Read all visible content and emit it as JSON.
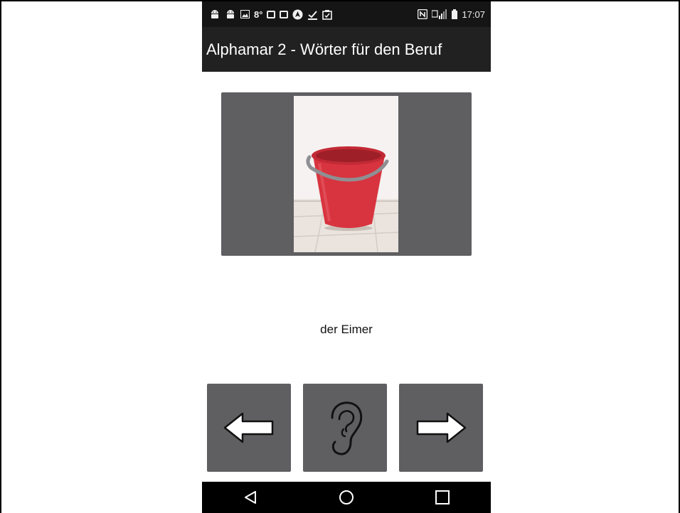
{
  "status_bar": {
    "left_icons": [
      "android-icon",
      "android-icon",
      "image-icon",
      "temperature-text",
      "app-icon",
      "app-icon",
      "navigation-icon",
      "download-done-icon",
      "clipboard-icon"
    ],
    "temperature": "8°",
    "right_icons": [
      "nfc-icon",
      "signal-icon",
      "battery-icon"
    ],
    "time": "17:07"
  },
  "app_bar": {
    "title": "Alphamar 2 - Wörter für den Beruf"
  },
  "card": {
    "image_subject": "red bucket"
  },
  "word": {
    "text": "der Eimer"
  },
  "controls": {
    "prev_icon": "left-arrow-icon",
    "listen_icon": "ear-icon",
    "next_icon": "right-arrow-icon"
  },
  "nav_bar": {
    "icons": [
      "back-triangle-icon",
      "home-circle-icon",
      "recents-square-icon"
    ]
  },
  "colors": {
    "status_bar": "#151515",
    "app_bar": "#212121",
    "card": "#5f5f62",
    "bucket": "#d8343f"
  }
}
